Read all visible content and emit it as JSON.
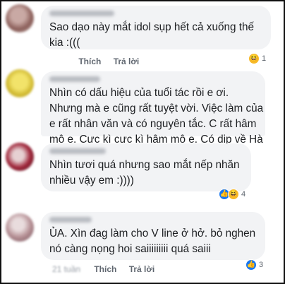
{
  "comments": [
    {
      "text_lines": [
        "Sao dạo này mắt idol sụp hết cả xuống thế",
        "kia :((("
      ],
      "actions": {
        "like": "Thích",
        "reply": "Trả lời"
      },
      "reactions": {
        "icons": [
          "haha-icon"
        ],
        "count": "1"
      },
      "avatar_color": "#a87a76"
    },
    {
      "text_lines": [
        "Nhìn có dấu hiệu của tuổi tác rồi e ơi.",
        "Nhưng mà e cũng rất tuyệt vời. Việc làm của",
        "e rất nhân văn và có nguyên tắc. C rất hâm",
        "mộ e. Cực kì cực kì hâm mộ e. Có dịp về Hà"
      ],
      "avatar_color": "#d8c23a"
    },
    {
      "text_lines": [
        "Nhìn tươi quá nhưng sao mắt nếp nhăn",
        "nhiều vậy em :))))"
      ],
      "reactions": {
        "icons": [
          "like-icon",
          "haha-icon"
        ],
        "count": "4"
      },
      "avatar_color": "#9b2b33"
    },
    {
      "text_lines": [
        "ỦA. Xìn đag làm cho V line ở hở. bỏ nghen",
        "nó càng nọng hoi saiiiiiiiii quá saiii"
      ],
      "actions": {
        "time": "21 tuần",
        "like": "Thích",
        "reply": "Trả lời"
      },
      "reactions": {
        "icons": [
          "like-icon"
        ],
        "count": "3"
      },
      "avatar_color": "#b08c90"
    }
  ],
  "colors": {
    "bubble": "#f2f3f5",
    "link": "#606770",
    "like_blue": "#1877f2",
    "haha_yellow": "#f7b928"
  }
}
